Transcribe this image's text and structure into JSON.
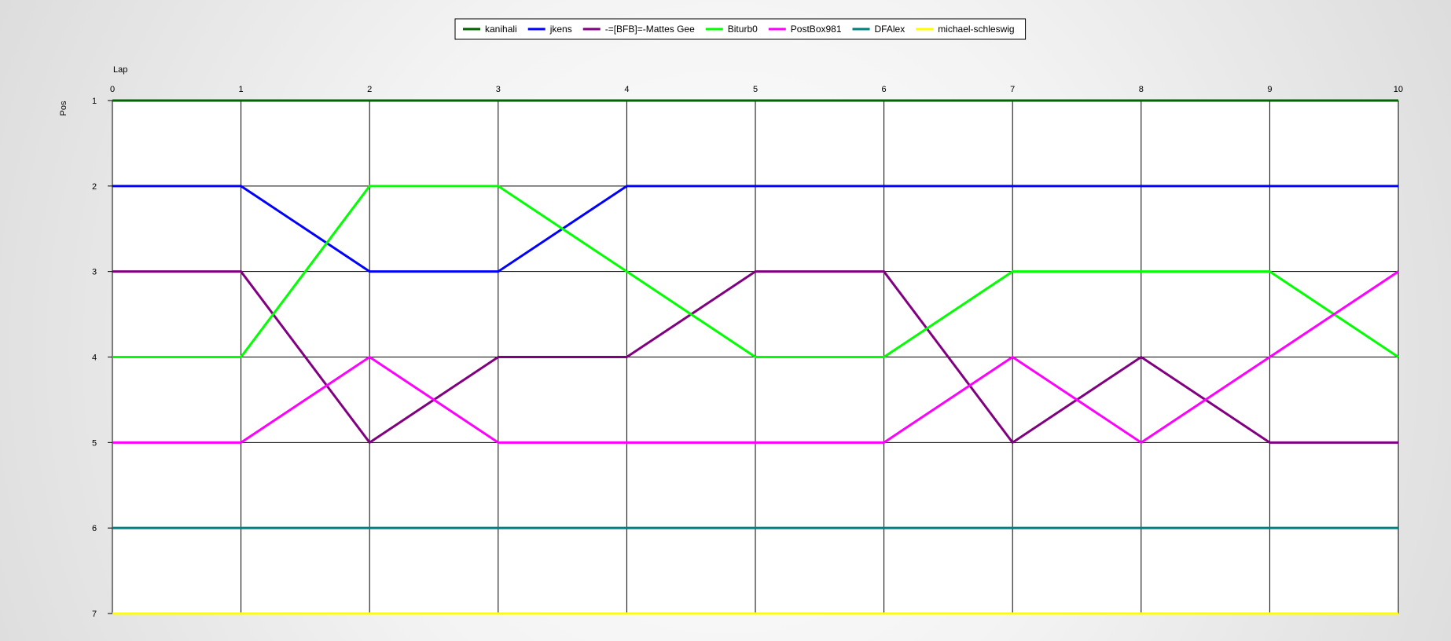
{
  "chart_data": {
    "type": "line",
    "xlabel": "Lap",
    "ylabel": "Pos",
    "x": [
      0,
      1,
      2,
      3,
      4,
      5,
      6,
      7,
      8,
      9,
      10
    ],
    "xlim": [
      0,
      10
    ],
    "ylim": [
      1,
      7
    ],
    "y_inverted": true,
    "y_ticks": [
      1,
      2,
      3,
      4,
      5,
      6,
      7
    ],
    "grid": true,
    "legend_position": "top-center",
    "series": [
      {
        "name": "kanihali",
        "color": "#006400",
        "values": [
          1,
          1,
          1,
          1,
          1,
          1,
          1,
          1,
          1,
          1,
          1
        ]
      },
      {
        "name": "jkens",
        "color": "#0000ff",
        "values": [
          2,
          2,
          3,
          3,
          2,
          2,
          2,
          2,
          2,
          2,
          2
        ]
      },
      {
        "name": "-=[BFB]=-Mattes Gee",
        "color": "#800080",
        "values": [
          3,
          3,
          5,
          4,
          4,
          3,
          3,
          5,
          4,
          5,
          5
        ]
      },
      {
        "name": "Biturb0",
        "color": "#00ff00",
        "values": [
          4,
          4,
          2,
          2,
          3,
          4,
          4,
          3,
          3,
          3,
          4
        ]
      },
      {
        "name": "PostBox981",
        "color": "#ff00ff",
        "values": [
          5,
          5,
          4,
          5,
          5,
          5,
          5,
          4,
          5,
          4,
          3
        ]
      },
      {
        "name": "DFAlex",
        "color": "#008080",
        "values": [
          6,
          6,
          6,
          6,
          6,
          6,
          6,
          6,
          6,
          6,
          6
        ]
      },
      {
        "name": "michael-schleswig",
        "color": "#ffff00",
        "values": [
          7,
          7,
          7,
          7,
          7,
          7,
          7,
          7,
          7,
          7,
          7
        ]
      }
    ]
  }
}
